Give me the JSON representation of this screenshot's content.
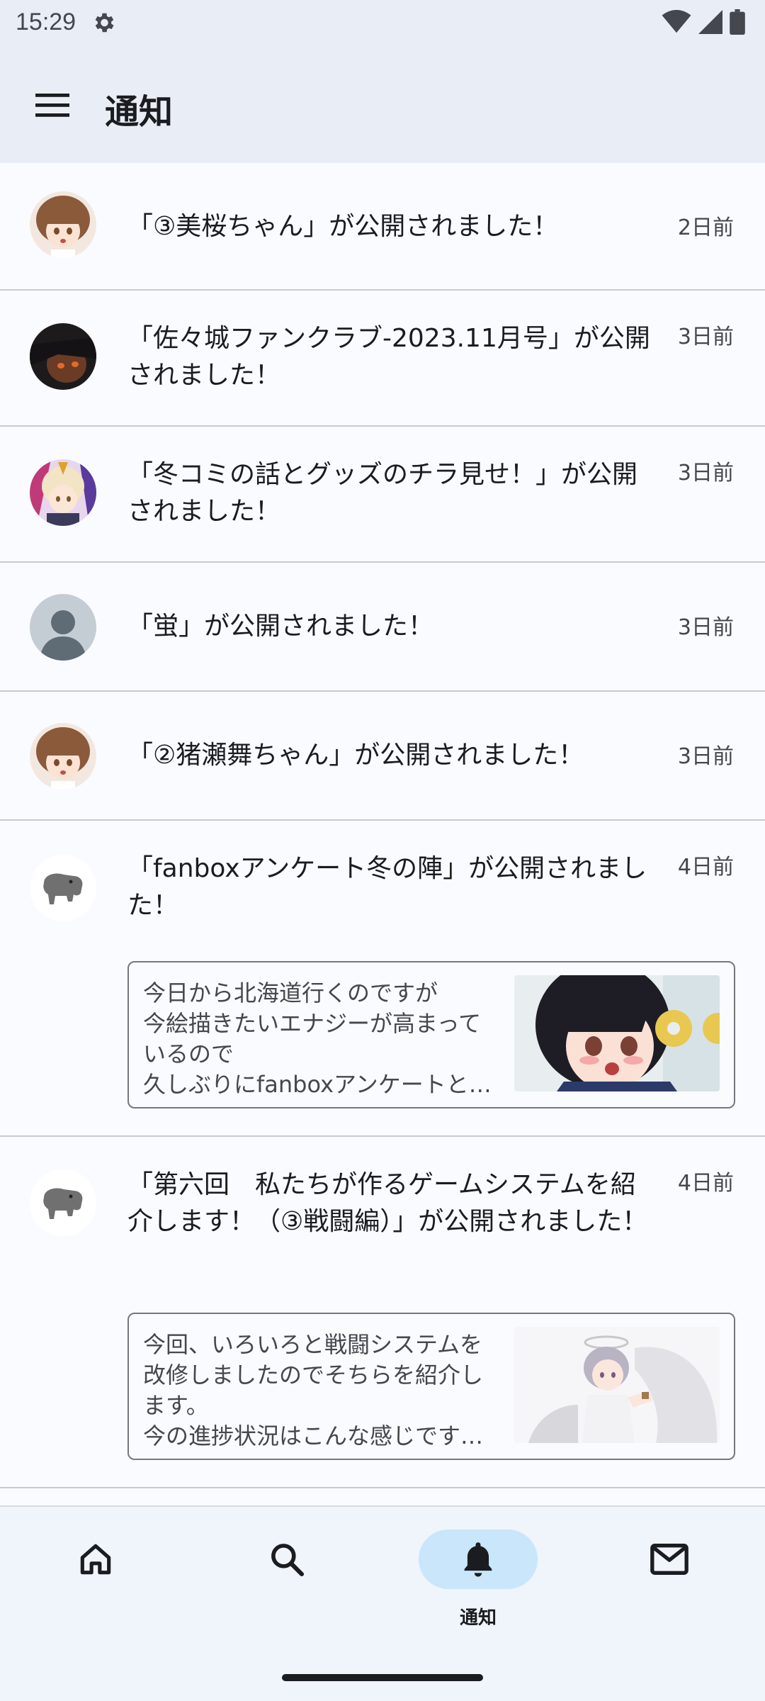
{
  "status_bar": {
    "time": "15:29"
  },
  "app_bar": {
    "title": "通知"
  },
  "notifications": [
    {
      "text": "「③美桜ちゃん」が公開されました！",
      "date": "2日前",
      "avatar": "girl-brown-hair-avatar"
    },
    {
      "text": "「佐々城ファンクラブ-2023.11月号」が公開されました！",
      "date": "3日前",
      "avatar": "dark-character-avatar"
    },
    {
      "text": "「冬コミの話とグッズのチラ見せ！」が公開されました！",
      "date": "3日前",
      "avatar": "colorful-character-avatar"
    },
    {
      "text": "「蛍」が公開されました！",
      "date": "3日前",
      "avatar": "default-person-avatar"
    },
    {
      "text": "「②猪瀬舞ちゃん」が公開されました！",
      "date": "3日前",
      "avatar": "girl-brown-hair-avatar"
    },
    {
      "text": "「fanboxアンケート冬の陣」が公開されました！",
      "date": "4日前",
      "avatar": "tapir-avatar",
      "preview": {
        "lines": [
          "今日から北海道行くのですが",
          "今絵描きたいエナジーが高まって",
          "いるので",
          "久しぶりにfanboxアンケートと…"
        ],
        "thumb": "black-hair-girl-illustration"
      }
    },
    {
      "text": "「第六回　私たちが作るゲームシステムを紹介します！（③戦闘編）」が公開されました！",
      "date": "4日前",
      "avatar": "tapir-avatar",
      "preview": {
        "lines": [
          "今回、いろいろと戦闘システムを",
          "改修しましたのでそちらを紹介し",
          "ます。",
          "今の進捗状況はこんな感じです…"
        ],
        "thumb": "white-angel-girl-illustration"
      }
    }
  ],
  "bottom_nav": {
    "items": [
      {
        "icon": "home-icon"
      },
      {
        "icon": "search-icon"
      },
      {
        "icon": "bell-icon",
        "label": "通知",
        "active": true
      },
      {
        "icon": "mail-icon"
      }
    ]
  },
  "colors": {
    "app_bar_bg": "#e9eef6",
    "active_indicator": "#c9e6fb",
    "divider": "#c8cacf"
  }
}
